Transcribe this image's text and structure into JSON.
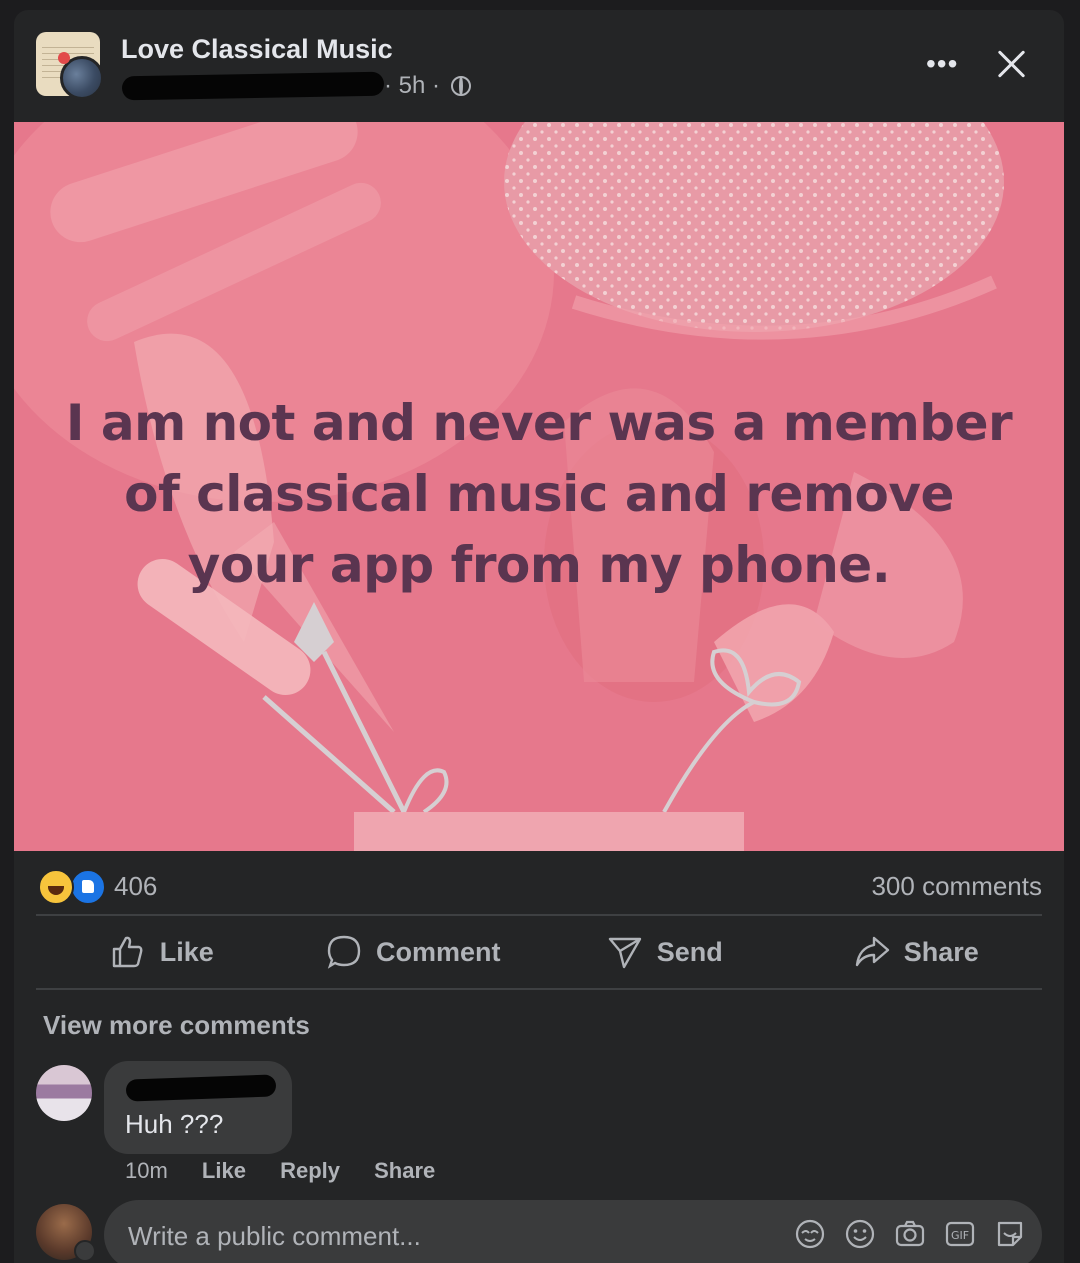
{
  "header": {
    "group_name": "Love Classical Music",
    "meta_time": "· 5h ·"
  },
  "post": {
    "text": "I am not and never was a member of classical music and remove your app from my phone."
  },
  "stats": {
    "reaction_count": "406",
    "comment_count": "300 comments"
  },
  "actions": {
    "like": "Like",
    "comment": "Comment",
    "send": "Send",
    "share": "Share"
  },
  "comments": {
    "view_more": "View more comments",
    "items": [
      {
        "text": "Huh ???",
        "time": "10m",
        "like": "Like",
        "reply": "Reply",
        "share": "Share"
      }
    ]
  },
  "composer": {
    "placeholder": "Write a public comment..."
  },
  "icons": [
    "globe-icon",
    "more-icon",
    "close-icon",
    "haha-reaction-icon",
    "like-reaction-icon",
    "thumbs-up-icon",
    "comment-bubble-icon",
    "send-icon",
    "share-arrow-icon",
    "avatar-sticker-icon",
    "emoji-icon",
    "camera-icon",
    "gif-icon",
    "sticker-icon"
  ],
  "colors": {
    "background": "#242526",
    "post_bg": "#e6788c",
    "post_text": "#5a3550",
    "like_blue": "#1b74e4"
  }
}
